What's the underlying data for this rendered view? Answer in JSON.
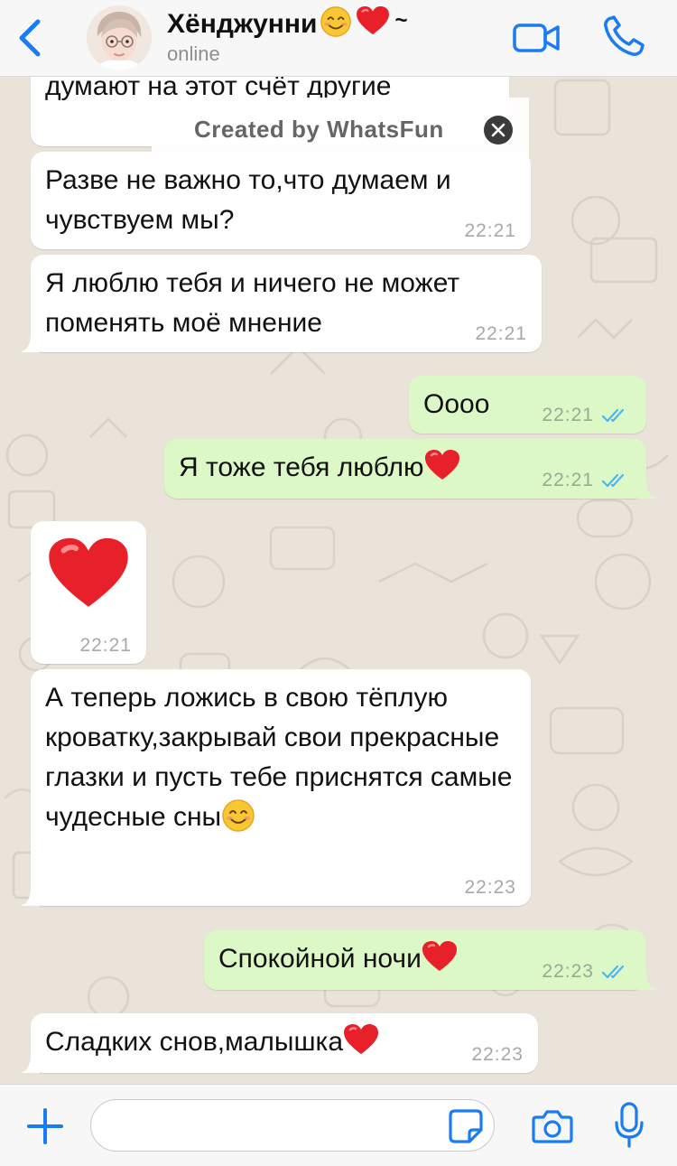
{
  "header": {
    "contact_name": "Хёнджунни",
    "contact_name_suffix": "~",
    "status": "online",
    "icons": {
      "back": "chevron-left-icon",
      "video": "video-camera-icon",
      "call": "phone-icon"
    }
  },
  "watermark": {
    "text": "Created by WhatsFun",
    "close_icon": "close-icon"
  },
  "messages": [
    {
      "direction": "in",
      "text": "думают на этот счёт другие",
      "time": ""
    },
    {
      "direction": "in",
      "text": "Разве не важно то,что думаем и чувствуем мы?",
      "time": "22:21"
    },
    {
      "direction": "in",
      "text": "Я люблю тебя и ничего не может поменять моё мнение",
      "time": "22:21"
    },
    {
      "direction": "out",
      "text": "Оооо",
      "time": "22:21",
      "read": true
    },
    {
      "direction": "out",
      "text": "Я тоже тебя люблю",
      "time": "22:21",
      "read": true,
      "emoji": "red-heart"
    },
    {
      "direction": "in",
      "text": "",
      "time": "22:21",
      "emoji": "big-red-heart"
    },
    {
      "direction": "in",
      "text": "А теперь ложись в свою тёплую кроватку,закрывай свои прекрасные глазки и пусть тебе приснятся самые чудесные сны",
      "time": "22:23",
      "emoji": "smiling-face"
    },
    {
      "direction": "out",
      "text": "Спокойной ночи",
      "time": "22:23",
      "read": true,
      "emoji": "red-heart"
    },
    {
      "direction": "in",
      "text": "Сладких снов,малышка",
      "time": "22:23",
      "emoji": "red-heart"
    }
  ],
  "composer": {
    "placeholder": "",
    "value": "",
    "icons": {
      "attach": "plus-icon",
      "sticker": "sticker-icon",
      "camera": "camera-icon",
      "mic": "microphone-icon"
    }
  },
  "colors": {
    "accent": "#1a7cf5",
    "incoming_bubble": "#ffffff",
    "outgoing_bubble": "#dcf8c6",
    "read_ticks": "#4fb6ec",
    "heart": "#e8202a",
    "wallpaper": "#e9e3da"
  }
}
